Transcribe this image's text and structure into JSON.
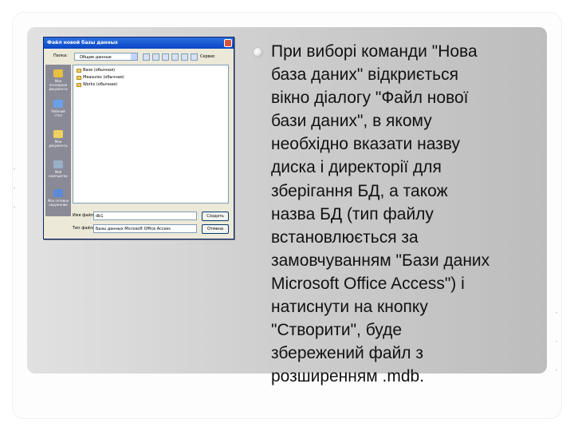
{
  "dialog": {
    "title": "Файл новой базы данных",
    "look_in_label": "Папка:",
    "look_in_value": "Общие данные",
    "tools_label": "Сервис",
    "places": [
      "Мои последние документы",
      "Рабочий стол",
      "Мои документы",
      "Мой компьютер",
      "Мое сетевое окружение"
    ],
    "files": [
      "Base (обычная)",
      "Measures (обычная)",
      "Works (обычная)"
    ],
    "filename_label": "Имя файла:",
    "filename_value": "db1",
    "filetype_label": "Тип файла:",
    "filetype_value": "Базы данных Microsoft Office Access",
    "create_button": "Создать",
    "cancel_button": "Отмена"
  },
  "body_text": "При виборі команди \"Нова\nбаза даних\" відкриється\nвікно діалогу \"Файл нової\nбази даних\", в якому\nнеобхідно вказати назву\nдиска і директорії для\nзберігання БД, а також\nназва БД (тип файлу\nвстановлюється за\nзамовчуванням \"Бази даних\nMicrosoft Office Access\") і\nнатиснути на кнопку\n\"Створити\", буде\nзбережений файл з\nрозширенням .mdb.",
  "colors": {
    "panel_gradient_start": "#e1e1e1",
    "panel_gradient_end": "#bdbdbd",
    "dialog_title_bar": "#0a46c6"
  }
}
